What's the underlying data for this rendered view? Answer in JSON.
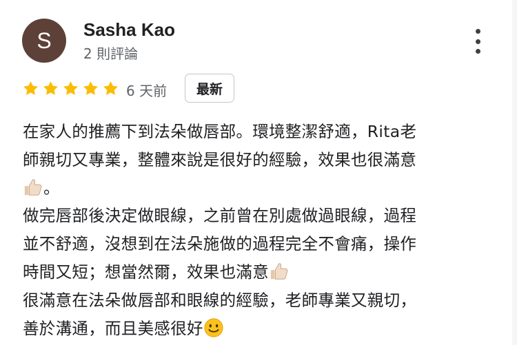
{
  "reviewer": {
    "avatar_letter": "S",
    "avatar_color": "#5d4037",
    "name": "Sasha Kao",
    "review_count": "2 則評論"
  },
  "menu_icon": "more-vert-icon",
  "rating": {
    "stars": 5,
    "max": 5,
    "star_color": "#fbbc04"
  },
  "time_ago": "6 天前",
  "badge": "最新",
  "review": {
    "lines": [
      "在家人的推薦下到法朵做唇部。環境整潔舒適，Rita老",
      "師親切又專業，整體來說是很好的經驗，效果也很滿意",
      "。",
      "做完唇部後決定做眼線，之前曾在別處做過眼線，過程",
      "並不舒適，沒想到在法朵施做的過程完全不會痛，操作",
      "時間又短；想當然爾，效果也滿意",
      "很滿意在法朵做唇部和眼線的經驗，老師專業又親切，",
      "善於溝通，而且美感很好"
    ],
    "emojis": [
      "thumbs-up-icon",
      "thumbs-up-icon",
      "smiling-face-icon"
    ]
  }
}
